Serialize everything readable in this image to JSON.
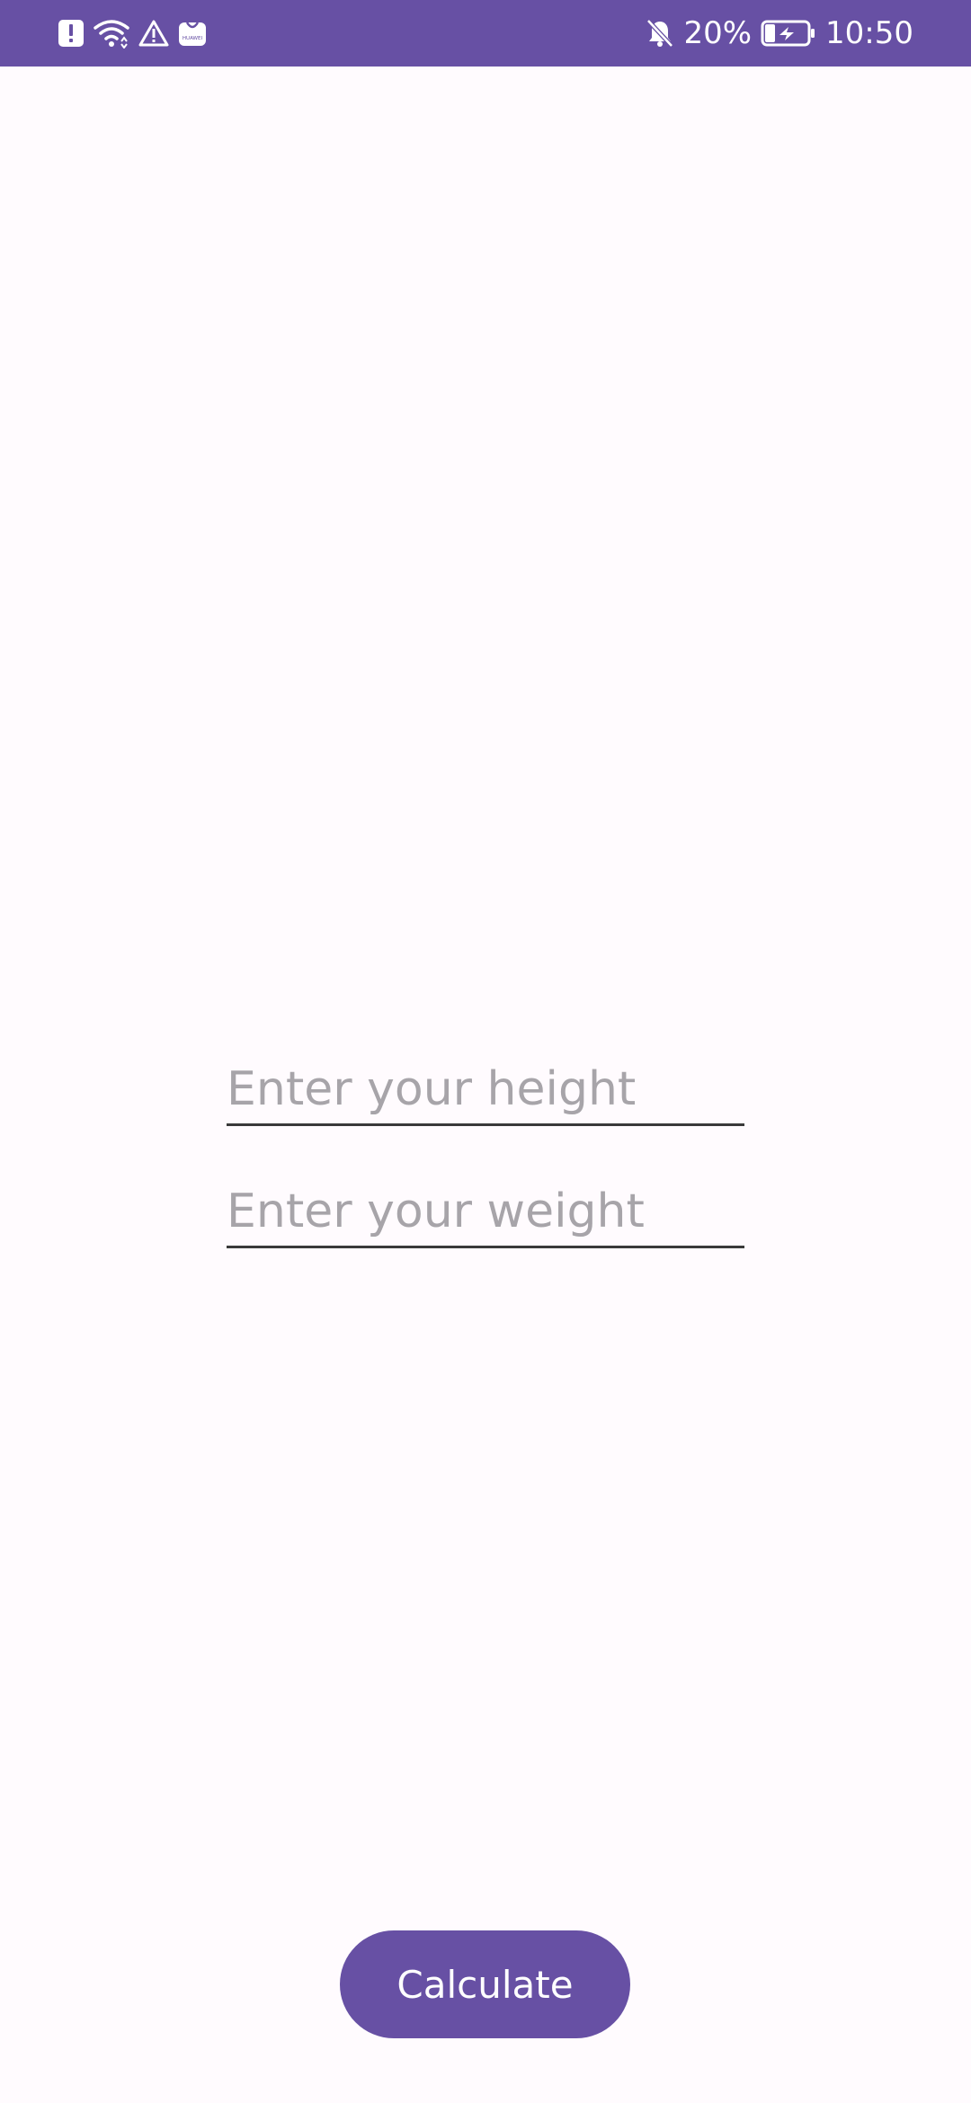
{
  "status_bar": {
    "battery": "20%",
    "time": "10:50",
    "left_icons": [
      "alert-notification-icon",
      "wifi-icon",
      "warning-icon",
      "huawei-store-icon"
    ],
    "huawei_label": "HUAWEI",
    "right_icons": [
      "bell-muted-icon",
      "battery-charging-icon"
    ]
  },
  "form": {
    "height_placeholder": "Enter your height",
    "height_value": "",
    "weight_placeholder": "Enter your weight",
    "weight_value": ""
  },
  "actions": {
    "calculate_label": "Calculate"
  },
  "colors": {
    "primary": "#6750a4",
    "background": "#fffbfe",
    "placeholder": "#a7a4a9",
    "underline": "#3a3a3a"
  }
}
